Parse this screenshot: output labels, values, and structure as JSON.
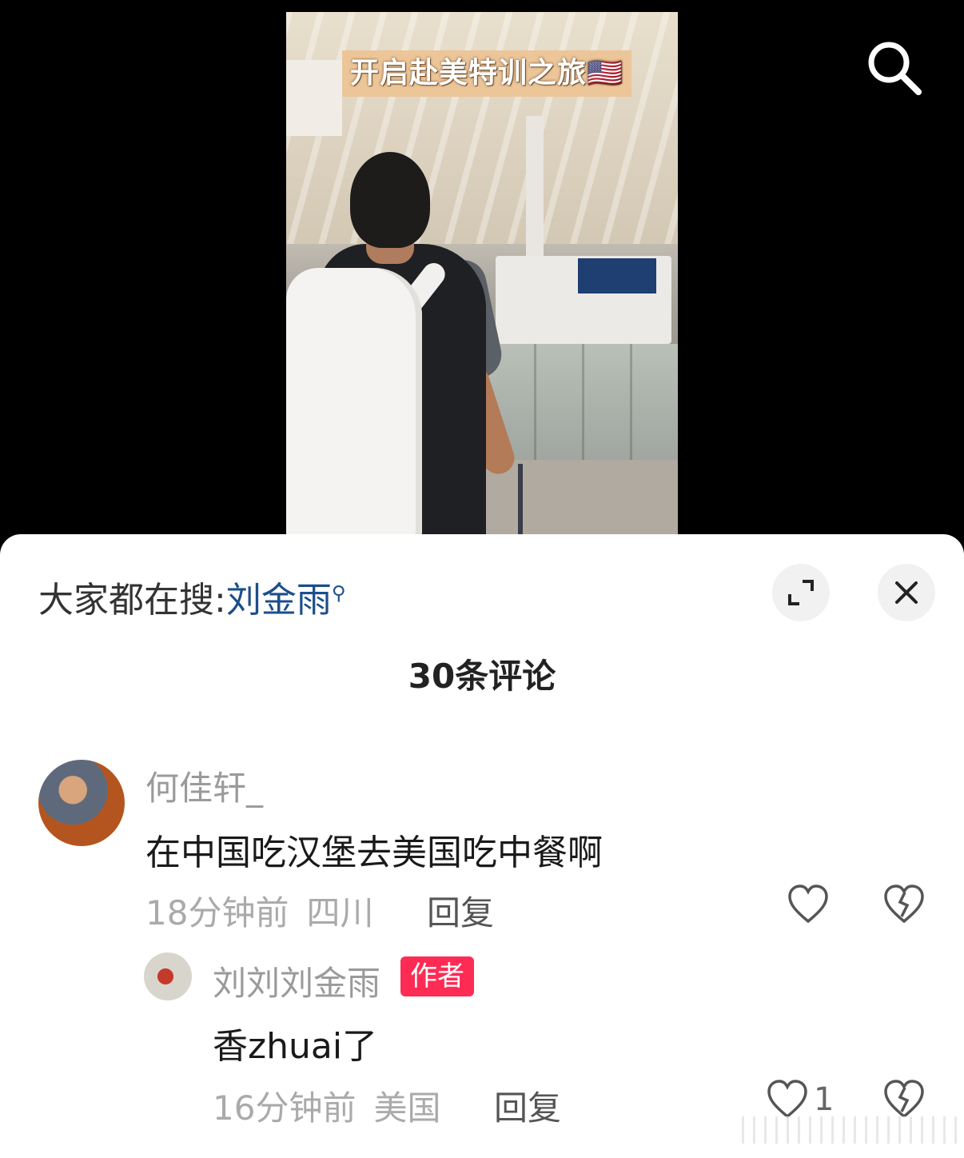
{
  "video": {
    "caption": "开启赴美特训之旅",
    "caption_flag": "🇺🇸"
  },
  "suggest": {
    "prefix": "大家都在搜:",
    "keyword": "刘金雨"
  },
  "comments_header": {
    "count_label": "30条评论"
  },
  "comments": [
    {
      "user": "何佳轩_",
      "text": "在中国吃汉堡去美国吃中餐啊",
      "time": "18分钟前",
      "location": "四川",
      "reply_label": "回复",
      "like_count": ""
    },
    {
      "user": "刘刘刘金雨",
      "badge": "作者",
      "text": "香zhuai了",
      "time": "16分钟前",
      "location": "美国",
      "reply_label": "回复",
      "like_count": "1"
    }
  ],
  "colors": {
    "keyword": "#1c4e8a",
    "author_badge": "#fe2c55",
    "sheet_bg": "#ffffff",
    "top_bg": "#000000"
  },
  "icons": {
    "search": "search-icon",
    "expand": "expand-icon",
    "close": "close-icon",
    "like": "heart-icon",
    "dislike": "broken-heart-icon"
  }
}
